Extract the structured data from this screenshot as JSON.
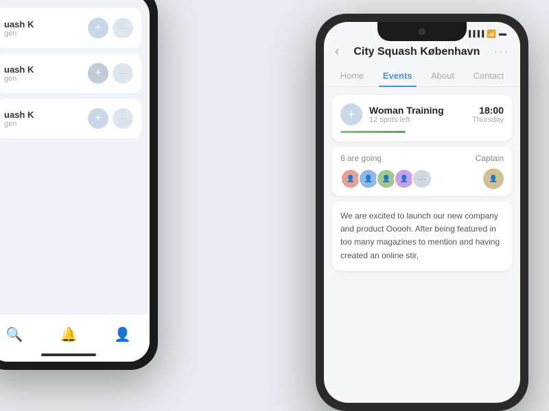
{
  "leftPhone": {
    "items": [
      {
        "name": "uash K",
        "sub": "gen"
      },
      {
        "name": "uash K",
        "sub": "gen"
      },
      {
        "name": "uash K",
        "sub": "gen"
      }
    ],
    "navIcons": [
      "🔍",
      "🔔",
      "👤"
    ]
  },
  "rightPhone": {
    "statusBar": {
      "signal": "▐▐▐▐",
      "wifi": "WiFi",
      "battery": "🔋"
    },
    "header": {
      "back": "‹",
      "title": "City Squash København",
      "more": "···"
    },
    "tabs": [
      {
        "label": "Home",
        "active": false
      },
      {
        "label": "Events",
        "active": true
      },
      {
        "label": "About",
        "active": false
      },
      {
        "label": "Contact",
        "active": false
      }
    ],
    "eventCard": {
      "name": "Woman Training",
      "spots": "12 spots left",
      "time": "18:00",
      "day": "Thursday"
    },
    "goingSection": {
      "count": "6 are going",
      "captainLabel": "Captain"
    },
    "description": {
      "text": "We are excited to launch our new company and product Ooooh. After being featured in too many magazines to mention and having created an online stir,"
    }
  }
}
